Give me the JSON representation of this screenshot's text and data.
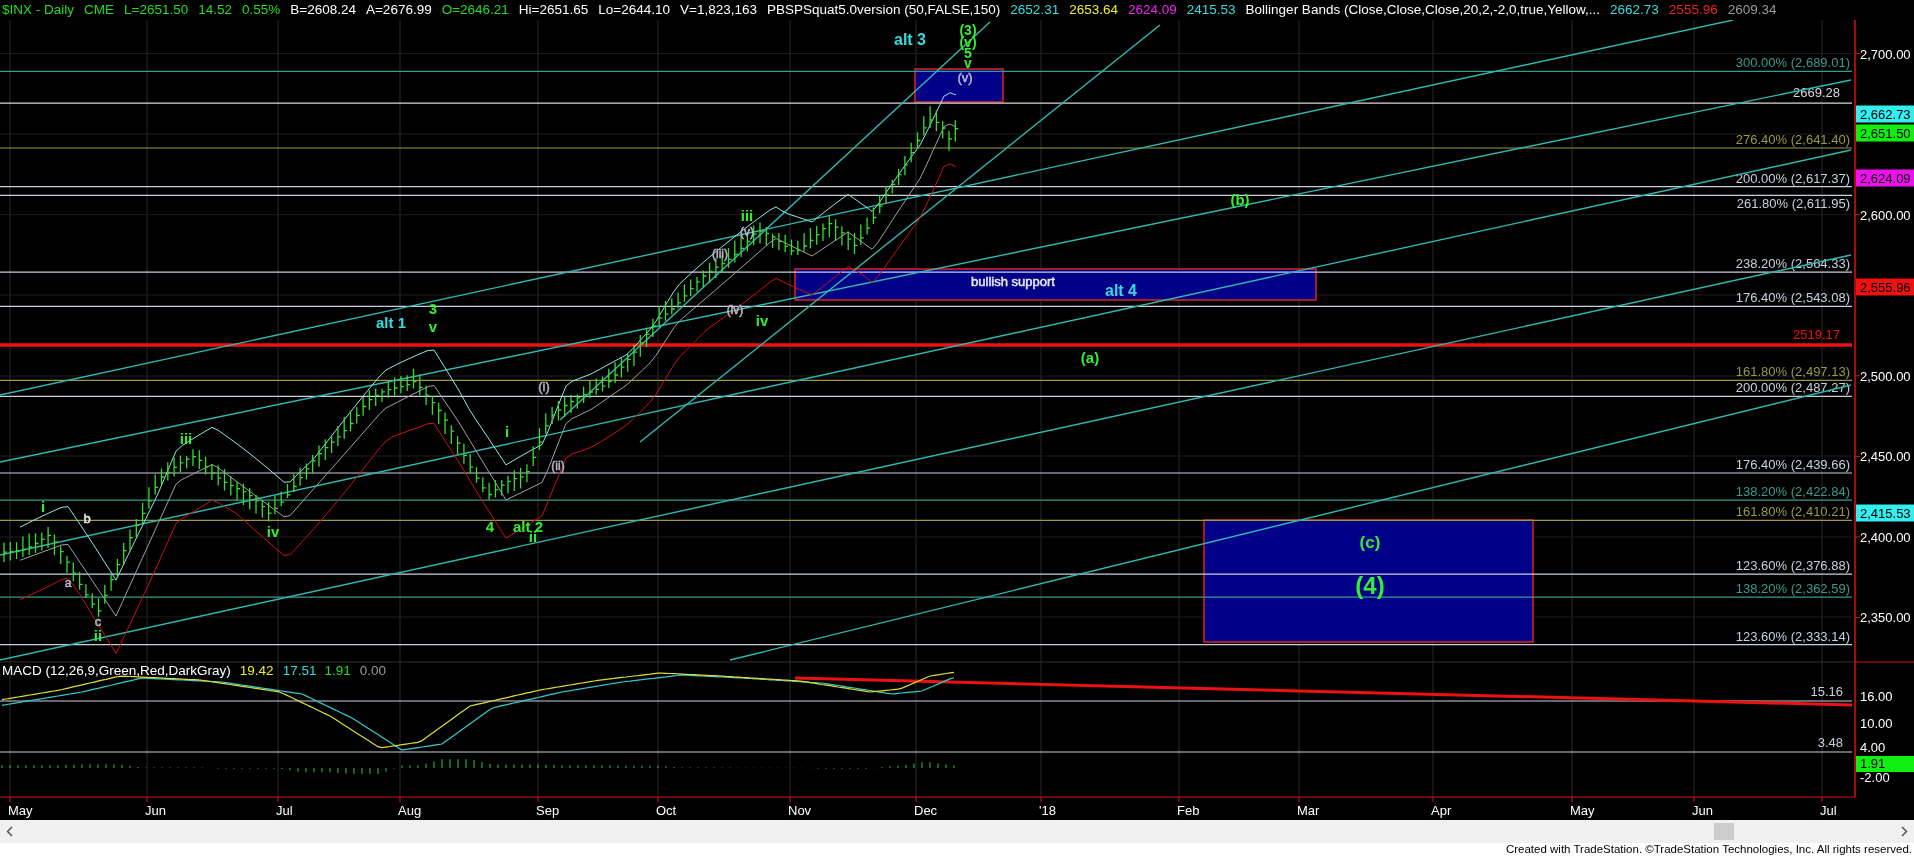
{
  "header": {
    "items": [
      {
        "text": "$INX - Daily",
        "color": "#22dd22"
      },
      {
        "text": "CME",
        "color": "#22dd22"
      },
      {
        "text": "L=2651.50",
        "color": "#22dd22"
      },
      {
        "text": "14.52",
        "color": "#22dd22"
      },
      {
        "text": "0.55%",
        "color": "#22dd22"
      },
      {
        "text": "B=2608.24",
        "color": "#ffffff"
      },
      {
        "text": "A=2676.99",
        "color": "#ffffff"
      },
      {
        "text": "O=2646.21",
        "color": "#22dd22"
      },
      {
        "text": "Hi=2651.65",
        "color": "#ffffff"
      },
      {
        "text": "Lo=2644.10",
        "color": "#ffffff"
      },
      {
        "text": "V=1,823,163",
        "color": "#ffffff"
      },
      {
        "text": "PBSPSquat5.0version (50,FALSE,150)",
        "color": "#ffffff"
      },
      {
        "text": "2652.31",
        "color": "#33dddd"
      },
      {
        "text": "2653.64",
        "color": "#eeee22"
      },
      {
        "text": "2624.09",
        "color": "#ee22ee"
      },
      {
        "text": "2415.53",
        "color": "#33dddd"
      },
      {
        "text": "Bollinger Bands (Close,Close,Close,20,2,-2,0,true,Yellow,...",
        "color": "#ffffff"
      },
      {
        "text": "2662.73",
        "color": "#33dddd"
      },
      {
        "text": "2555.96",
        "color": "#ee2222"
      },
      {
        "text": "2609.34",
        "color": "#999999"
      }
    ]
  },
  "price_panel": {
    "fib_levels": [
      {
        "label": "300.00% (2,689.01)",
        "color": "#3a9a8c"
      },
      {
        "label": "276.40% (2,641.40)",
        "color": "#9a9a44"
      },
      {
        "label": "200.00% (2,617.37)",
        "color": "#c8d0e0"
      },
      {
        "label": "261.80% (2,611.95)",
        "color": "#c8d0e0"
      },
      {
        "label": "238.20% (2,564.33)",
        "color": "#c8d0e0"
      },
      {
        "label": "176.40% (2,543.08)",
        "color": "#c8d0e0"
      },
      {
        "label": "161.80% (2,497.13)",
        "color": "#9a9a44"
      },
      {
        "label": "200.00% (2,487.27)",
        "color": "#c8d0e0"
      },
      {
        "label": "176.40% (2,439.66)",
        "color": "#c8d0e0"
      },
      {
        "label": "138.20% (2,422.84)",
        "color": "#3a9a8c"
      },
      {
        "label": "161.80% (2,410.21)",
        "color": "#9a9a44"
      },
      {
        "label": "123.60% (2,376.88)",
        "color": "#c8d0e0"
      },
      {
        "label": "138.20% (2,362.59)",
        "color": "#3a9a8c"
      },
      {
        "label": "123.60% (2,333.14)",
        "color": "#c8d0e0"
      }
    ],
    "levels": [
      {
        "label": "2669.28",
        "color": "#d8d8d8"
      },
      {
        "label": "2519.17",
        "color": "#ee1111"
      }
    ],
    "wave_labels": [
      {
        "text": "(3)",
        "color": "#33ee33"
      },
      {
        "text": "(v)",
        "color": "#33ee33"
      },
      {
        "text": "5",
        "color": "#33ee33"
      },
      {
        "text": "v",
        "color": "#33ee33"
      },
      {
        "text": "alt 3",
        "color": "#33dddd"
      },
      {
        "text": "(v)",
        "color": "#b8b8c8"
      },
      {
        "text": "(b)",
        "color": "#33ee33"
      },
      {
        "text": "iii",
        "color": "#33ee33"
      },
      {
        "text": "(v)",
        "color": "#b8b8c8"
      },
      {
        "text": "(iii)",
        "color": "#b8b8c8"
      },
      {
        "text": "bullish support",
        "color": "#e8e8f0"
      },
      {
        "text": "alt 4",
        "color": "#33dddd"
      },
      {
        "text": "(iv)",
        "color": "#b8b8c8"
      },
      {
        "text": "iv",
        "color": "#33ee33"
      },
      {
        "text": "3",
        "color": "#33ee33"
      },
      {
        "text": "alt 1",
        "color": "#33dddd"
      },
      {
        "text": "v",
        "color": "#33ee33"
      },
      {
        "text": "(a)",
        "color": "#33ee33"
      },
      {
        "text": "(i)",
        "color": "#b8b8c8"
      },
      {
        "text": "i",
        "color": "#33ee33"
      },
      {
        "text": "iii",
        "color": "#33ee33"
      },
      {
        "text": "(ii)",
        "color": "#b8b8c8"
      },
      {
        "text": "i",
        "color": "#33ee33"
      },
      {
        "text": "b",
        "color": "#e8e8f0"
      },
      {
        "text": "4",
        "color": "#33ee33"
      },
      {
        "text": "alt 2",
        "color": "#33ee33"
      },
      {
        "text": "iv",
        "color": "#33ee33"
      },
      {
        "text": "ii",
        "color": "#33ee33"
      },
      {
        "text": "(c)",
        "color": "#33ee33"
      },
      {
        "text": "a",
        "color": "#b8b8c8"
      },
      {
        "text": "(4)",
        "color": "#33ee33"
      },
      {
        "text": "c",
        "color": "#b8b8c8"
      },
      {
        "text": "ii",
        "color": "#33ee33"
      }
    ],
    "axis_ticks": [
      "2,700.00",
      "2,600.00",
      "2,500.00",
      "2,450.00",
      "2,400.00",
      "2,350.00"
    ],
    "price_tags": [
      {
        "text": "2,662.73",
        "color": "#33eeee"
      },
      {
        "text": "2,651.50",
        "color": "#11ee11"
      },
      {
        "text": "2,624.09",
        "color": "#ee11ee"
      },
      {
        "text": "2,555.96",
        "color": "#ee1111"
      },
      {
        "text": "2,415.53",
        "color": "#33eeee"
      }
    ]
  },
  "macd_panel": {
    "items": [
      {
        "text": "MACD (12,26,9,Green,Red,DarkGray)",
        "color": "#ffffff"
      },
      {
        "text": "19.42",
        "color": "#eeee22"
      },
      {
        "text": "17.51",
        "color": "#33dddd"
      },
      {
        "text": "1.91",
        "color": "#22dd22"
      },
      {
        "text": "0.00",
        "color": "#999999"
      }
    ],
    "levels": [
      "15.16",
      "3.48"
    ],
    "axis_ticks": [
      "16.00",
      "10.00",
      "4.00",
      "-2.00"
    ],
    "tag": {
      "text": "1.91",
      "color": "#11ee11"
    }
  },
  "date_axis": [
    "May",
    "Jun",
    "Jul",
    "Aug",
    "Sep",
    "Oct",
    "Nov",
    "Dec",
    "'18",
    "Feb",
    "Mar",
    "Apr",
    "May",
    "Jun",
    "Jul"
  ],
  "footer": "Created with TradeStation. ©TradeStation Technologies, Inc. All rights reserved."
}
